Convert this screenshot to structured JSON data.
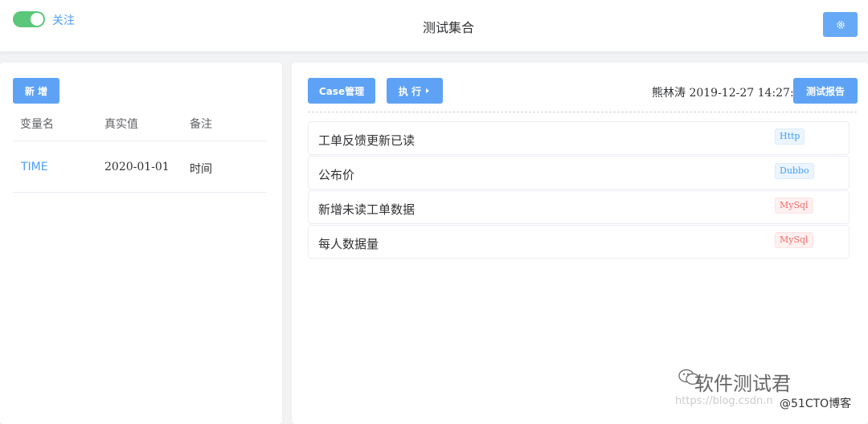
{
  "header": {
    "toggle_label": "关注",
    "title": "测试集合",
    "settings_icon": "gear-icon"
  },
  "variables_panel": {
    "add_button": "新 增",
    "columns": [
      "变量名",
      "真实值",
      "备注"
    ],
    "rows": [
      {
        "name": "TIME",
        "value": "2020-01-01",
        "note": "时间"
      }
    ]
  },
  "cases_panel": {
    "case_manage_button": "Case管理",
    "execute_button": "执 行",
    "meta": "熊林涛 2019-12-27 14:27:42",
    "report_button": "测试报告",
    "cases": [
      {
        "name": "工单反馈更新已读",
        "tag": "Http",
        "tag_color": "blue"
      },
      {
        "name": "公布价",
        "tag": "Dubbo",
        "tag_color": "blue"
      },
      {
        "name": "新增未读工单数据",
        "tag": "MySql",
        "tag_color": "red"
      },
      {
        "name": "每人数据量",
        "tag": "MySql",
        "tag_color": "red"
      }
    ]
  },
  "watermark": {
    "account": "软件测试君",
    "url": "https://blog.csdn.n",
    "site": "@51CTO博客"
  },
  "colors": {
    "primary": "#5ea2f5",
    "toggle_on": "#5bc77a",
    "tag_blue": "#409eff",
    "tag_red": "#f56c6c"
  }
}
